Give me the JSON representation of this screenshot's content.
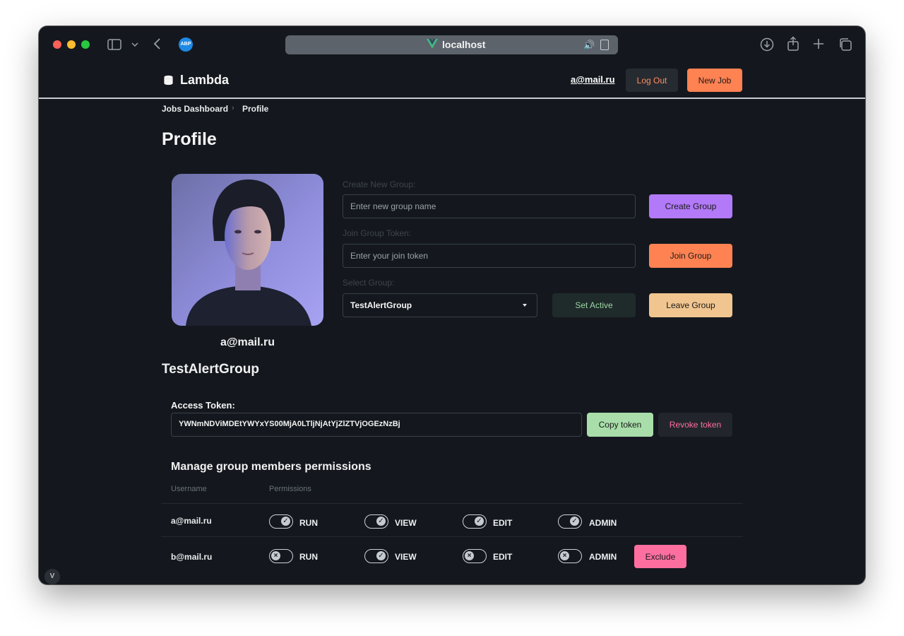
{
  "browser": {
    "url": "localhost",
    "adblock_badge": "ABP"
  },
  "navbar": {
    "brand": "Lambda",
    "user_email": "a@mail.ru",
    "logout_label": "Log Out",
    "new_job_label": "New Job"
  },
  "breadcrumb": {
    "items": [
      "Jobs Dashboard",
      "Profile"
    ],
    "separator": "›"
  },
  "page": {
    "title": "Profile"
  },
  "profile": {
    "email": "a@mail.ru"
  },
  "groups_form": {
    "create_label": "Create New Group:",
    "create_placeholder": "Enter new group name",
    "create_button": "Create Group",
    "join_label": "Join Group Token:",
    "join_placeholder": "Enter your join token",
    "join_button": "Join Group",
    "select_label": "Select Group:",
    "selected_group": "TestAlertGroup",
    "set_active_button": "Set Active",
    "leave_button": "Leave Group"
  },
  "group": {
    "name": "TestAlertGroup",
    "token_label": "Access Token:",
    "token_value": "YWNmNDViMDEtYWYxYS00MjA0LTljNjAtYjZlZTVjOGEzNzBj",
    "copy_button": "Copy token",
    "revoke_button": "Revoke token"
  },
  "members": {
    "title": "Manage group members permissions",
    "headers": [
      "Username",
      "Permissions"
    ],
    "rows": [
      {
        "username": "a@mail.ru",
        "permissions": [
          {
            "name": "RUN",
            "enabled": true
          },
          {
            "name": "VIEW",
            "enabled": true
          },
          {
            "name": "EDIT",
            "enabled": true
          },
          {
            "name": "ADMIN",
            "enabled": true
          }
        ]
      },
      {
        "username": "b@mail.ru",
        "permissions": [
          {
            "name": "RUN",
            "enabled": false
          },
          {
            "name": "VIEW",
            "enabled": true
          },
          {
            "name": "EDIT",
            "enabled": false
          },
          {
            "name": "ADMIN",
            "enabled": false
          }
        ],
        "exclude_label": "Exclude"
      }
    ]
  },
  "colors": {
    "background": "#14181e",
    "accent_orange": "#ff8252",
    "accent_purple": "#b279f8",
    "accent_peach": "#f0c58f",
    "accent_green": "#a9deaa",
    "accent_pink": "#fe6fa0",
    "revoke_text": "#ff6d9f"
  },
  "icons": {
    "brand": "database-icon",
    "toggle_on": "check-icon",
    "toggle_off": "x-icon"
  }
}
